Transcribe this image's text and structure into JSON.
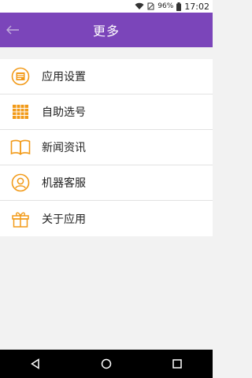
{
  "status_bar": {
    "battery": "96%",
    "time": "17:02"
  },
  "app_bar": {
    "title": "更多"
  },
  "menu": [
    {
      "label": "应用设置",
      "icon": "settings-card-icon"
    },
    {
      "label": "自助选号",
      "icon": "grid-table-icon"
    },
    {
      "label": "新闻资讯",
      "icon": "open-book-icon"
    },
    {
      "label": "机器客服",
      "icon": "user-headset-icon"
    },
    {
      "label": "关于应用",
      "icon": "gift-box-icon"
    }
  ],
  "colors": {
    "app_bar": "#7b45ba",
    "icon_accent": "#f29a18",
    "background": "#f2f2f2"
  }
}
